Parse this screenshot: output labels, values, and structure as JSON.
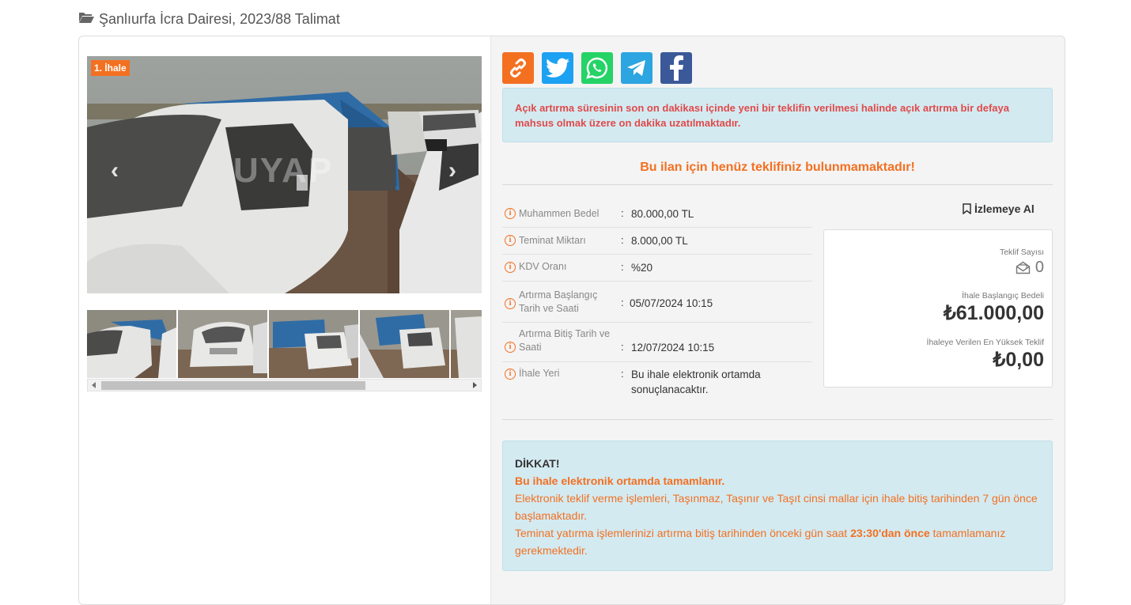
{
  "header": {
    "title": "Şanlıurfa İcra Dairesi, 2023/88 Talimat",
    "icon": "folder-open-icon"
  },
  "gallery": {
    "badge": "1. İhale",
    "watermark": "UYAP",
    "prev_icon": "chevron-left-icon",
    "next_icon": "chevron-right-icon"
  },
  "share": [
    {
      "name": "link",
      "icon": "link-icon",
      "color": "#f37021"
    },
    {
      "name": "twitter",
      "icon": "twitter-icon",
      "color": "#1da1f2"
    },
    {
      "name": "whatsapp",
      "icon": "whatsapp-icon",
      "color": "#25d366"
    },
    {
      "name": "telegram",
      "icon": "telegram-icon",
      "color": "#2ca5e0"
    },
    {
      "name": "facebook",
      "icon": "facebook-icon",
      "color": "#3b5998"
    }
  ],
  "alert_top": "Açık artırma süresinin son on dakikası içinde yeni bir teklifin verilmesi halinde açık artırma bir defaya mahsus olmak üzere on dakika uzatılmaktadır.",
  "no_offer": "Bu ilan için henüz teklifiniz bulunmamaktadır!",
  "info": [
    {
      "label": "Muhammen Bedel",
      "value": "80.000,00 TL"
    },
    {
      "label": "Teminat Miktarı",
      "value": "8.000,00 TL"
    },
    {
      "label": "KDV Oranı",
      "value": "%20"
    },
    {
      "label": "Artırma Başlangıç Tarih ve Saati",
      "value": "05/07/2024 10:15"
    },
    {
      "label": "Artırma Bitiş Tarih ve Saati",
      "value": "12/07/2024 10:15"
    },
    {
      "label": "İhale Yeri",
      "value": "Bu ihale elektronik ortamda sonuçlanacaktır."
    }
  ],
  "watch_label": "İzlemeye Al",
  "stats": {
    "offer_count_label": "Teklif Sayısı",
    "offer_count": "0",
    "start_price_label": "İhale Başlangıç Bedeli",
    "start_price": "₺61.000,00",
    "highest_label": "İhaleye Verilen En Yüksek Teklif",
    "highest": "₺0,00"
  },
  "alert_bottom": {
    "title": "DİKKAT!",
    "line1": "Bu ihale elektronik ortamda tamamlanır.",
    "line2": "Elektronik teklif verme işlemleri, Taşınmaz, Taşınır ve Taşıt cinsi mallar için ihale bitiş tarihinden 7 gün önce başlamaktadır.",
    "line3_pre": "Teminat yatırma işlemlerinizi artırma bitiş tarihinden önceki gün saat ",
    "line3_bold": "23:30'dan önce",
    "line3_post": " tamamlamanız gerekmektedir."
  }
}
